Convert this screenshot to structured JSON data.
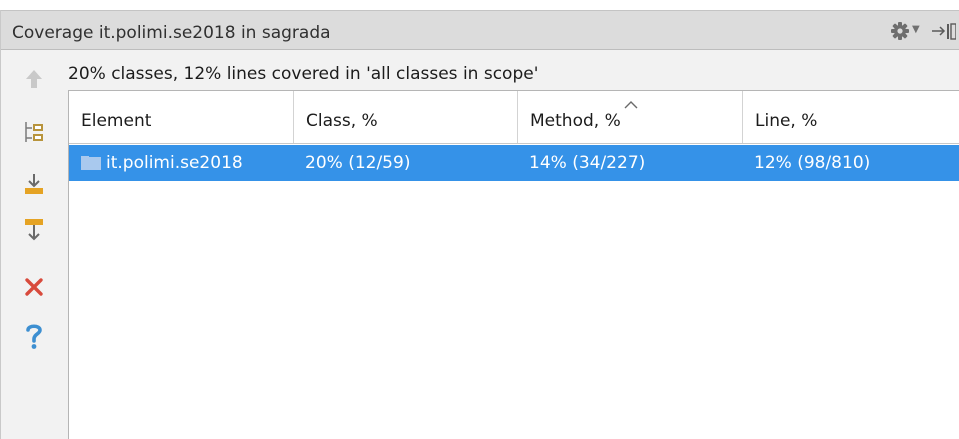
{
  "panel": {
    "title": "Coverage it.polimi.se2018 in sagrada",
    "icons": [
      "gear-icon",
      "dropdown-caret-icon",
      "hide-panel-icon"
    ]
  },
  "toolbar": {
    "items": [
      {
        "name": "up-arrow-icon",
        "enabled": false
      },
      {
        "name": "flatten-packages-icon",
        "enabled": true
      },
      {
        "name": "generate-report-icon",
        "enabled": true
      },
      {
        "name": "autoscroll-to-source-icon",
        "enabled": true
      },
      {
        "name": "close-icon",
        "enabled": true
      },
      {
        "name": "help-icon",
        "enabled": true
      }
    ]
  },
  "summary": "20% classes, 12% lines covered in 'all classes in scope'",
  "table": {
    "headers": [
      "Element",
      "Class, %",
      "Method, %",
      "Line, %"
    ],
    "sorted_column": "Method, %",
    "rows": [
      {
        "element": "it.polimi.se2018",
        "class": "20% (12/59)",
        "method": "14% (34/227)",
        "line": "12% (98/810)",
        "selected": true
      }
    ]
  },
  "colors": {
    "selection": "#3592e8",
    "close": "#d84a3c",
    "help": "#3d8fd1",
    "accent": "#e5a324"
  }
}
